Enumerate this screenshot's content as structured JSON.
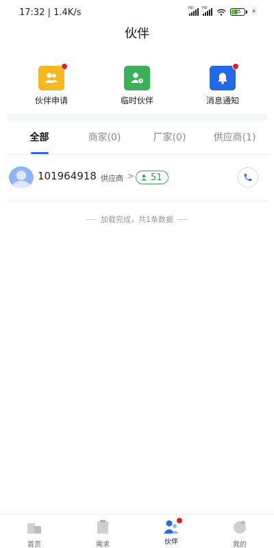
{
  "status_bar": {
    "time": "17:32 | 1.4K/s",
    "battery": "25",
    "network_tag": "HD"
  },
  "header": {
    "title": "伙伴"
  },
  "quick_actions": [
    {
      "label": "伙伴申请",
      "icon": "partner-request-icon",
      "color": "#f5b821",
      "has_dot": true
    },
    {
      "label": "临时伙伴",
      "icon": "temp-partner-icon",
      "color": "#3cb05a",
      "has_dot": false
    },
    {
      "label": "消息通知",
      "icon": "notification-bell-icon",
      "color": "#2468e6",
      "has_dot": true
    }
  ],
  "tabs": [
    {
      "label": "全部",
      "active": true
    },
    {
      "label": "商家(0)",
      "active": false
    },
    {
      "label": "厂家(0)",
      "active": false
    },
    {
      "label": "供应商(1)",
      "active": false
    }
  ],
  "partners": [
    {
      "name": "101964918",
      "role": "供应商",
      "chevron": ">",
      "score": "51"
    }
  ],
  "list_footer": "加载完成，共1条数据",
  "bottom_nav": [
    {
      "label": "首页",
      "icon": "home-icon",
      "active": false
    },
    {
      "label": "需求",
      "icon": "demand-icon",
      "active": false
    },
    {
      "label": "伙伴",
      "icon": "partner-icon",
      "active": true
    },
    {
      "label": "我的",
      "icon": "profile-icon",
      "active": false
    }
  ],
  "colors": {
    "accent": "#2d6be4",
    "badge_green": "#2f9b52",
    "dot_red": "#e02020"
  }
}
